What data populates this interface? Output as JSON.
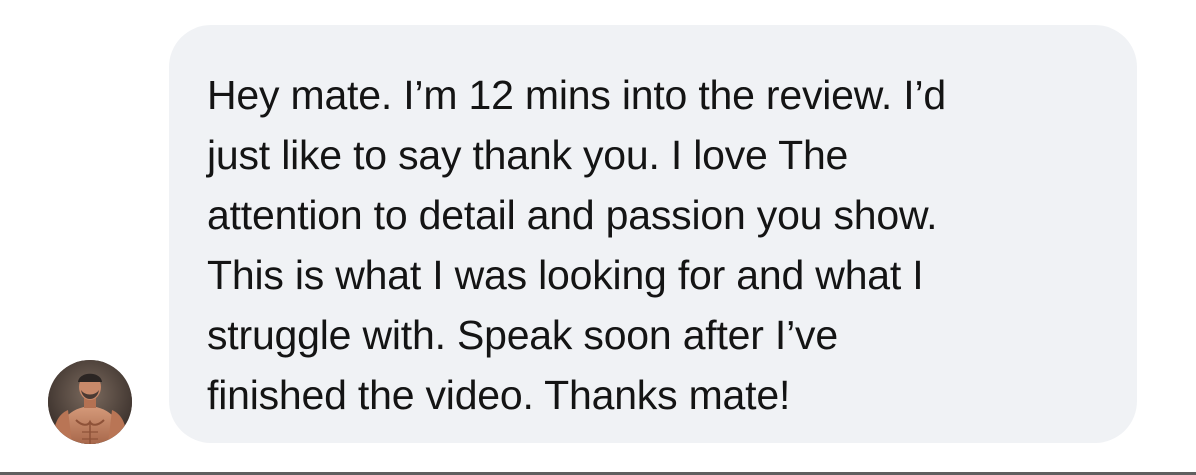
{
  "message": {
    "lines": [
      "Hey mate. I’m 12 mins into the review. I’d",
      "just like to say thank you. I love The",
      "attention to detail and passion you show.",
      "This is what I was looking for and what I",
      "struggle with. Speak soon after I’ve",
      "finished the video. Thanks mate!"
    ]
  },
  "sender": {
    "avatar_icon": "profile-photo"
  },
  "colors": {
    "bubble_background": "#f0f2f5",
    "text": "#141414",
    "page_background": "#ffffff"
  }
}
